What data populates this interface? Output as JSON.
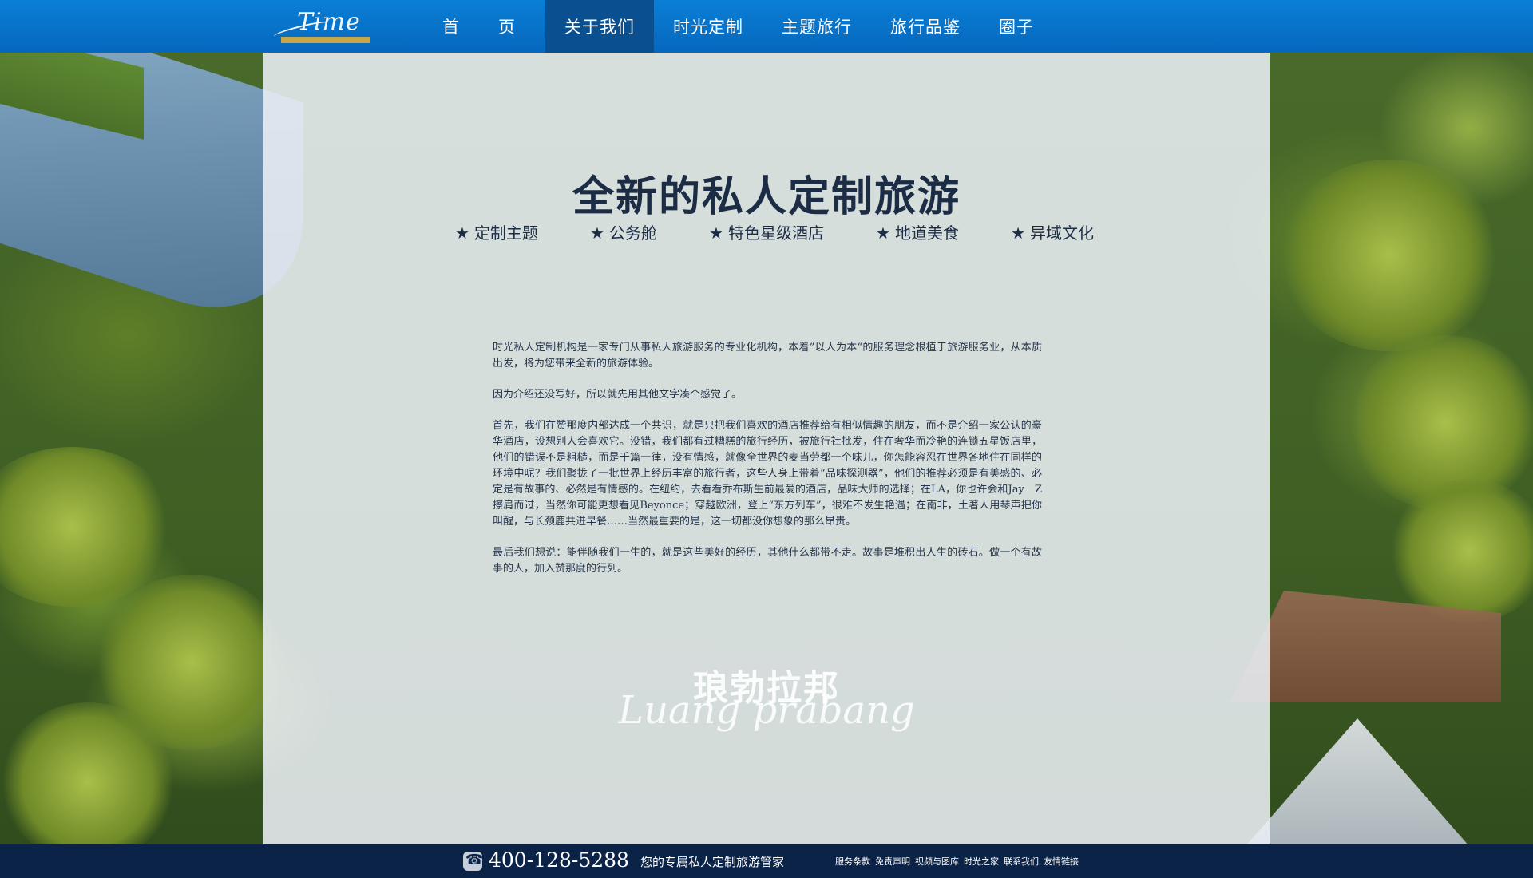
{
  "header": {
    "logo_text": "Time",
    "logo_icon": "time-logo",
    "nav": [
      {
        "label": "首　页"
      },
      {
        "label": "关于我们",
        "active": true
      },
      {
        "label": "时光定制"
      },
      {
        "label": "主题旅行"
      },
      {
        "label": "旅行品鉴"
      },
      {
        "label": "圈子"
      }
    ],
    "accent_color": "#0a7fd6",
    "active_color": "#0a4f8f"
  },
  "main": {
    "title": "全新的私人定制旅游",
    "tags": [
      {
        "icon": "star-icon",
        "star": "★",
        "label": "定制主题"
      },
      {
        "icon": "star-icon",
        "star": "★",
        "label": "公务舱"
      },
      {
        "icon": "star-icon",
        "star": "★",
        "label": "特色星级酒店"
      },
      {
        "icon": "star-icon",
        "star": "★",
        "label": "地道美食"
      },
      {
        "icon": "star-icon",
        "star": "★",
        "label": "异域文化"
      }
    ],
    "paragraphs": [
      "时光私人定制机构是一家专门从事私人旅游服务的专业化机构，本着”以人为本“的服务理念根植于旅游服务业，从本质出发，将为您带来全新的旅游体验。",
      "因为介绍还没写好，所以就先用其他文字凑个感觉了。",
      "首先，我们在赞那度内部达成一个共识，就是只把我们喜欢的酒店推荐给有相似情趣的朋友，而不是介绍一家公认的豪华酒店，设想别人会喜欢它。没错，我们都有过糟糕的旅行经历，被旅行社批发，住在奢华而冷艳的连锁五星饭店里，他们的错误不是粗糙，而是千篇一律，没有情感，就像全世界的麦当劳都一个味儿，你怎能容忍在世界各地住在同样的环境中呢？我们聚拢了一批世界上经历丰富的旅行者，这些人身上带着“品味探测器”，他们的推荐必须是有美感的、必定是有故事的、必然是有情感的。在纽约，去看看乔布斯生前最爱的酒店，品味大师的选择；在LA，你也许会和Jay　Z擦肩而过，当然你可能更想看见Beyonce；穿越欧洲，登上“东方列车”，很难不发生艳遇；在南非，土著人用琴声把你叫醒，与长颈鹿共进早餐……当然最重要的是，这一切都没你想象的那么昂贵。",
      "最后我们想说：能伴随我们一生的，就是这些美好的经历，其他什么都带不走。故事是堆积出人生的砖石。做一个有故事的人，加入赞那度的行列。"
    ],
    "place_cn": "琅勃拉邦",
    "place_en": "Luang prabang"
  },
  "footer": {
    "phone_icon": "phone-icon",
    "phone": "400-128-5288",
    "slogan": "您的专属私人定制旅游管家",
    "links": [
      "服务条款",
      "免责声明",
      "视频与图库",
      "时光之家",
      "联系我们",
      "友情链接"
    ],
    "bg_color": "#0b2347"
  }
}
